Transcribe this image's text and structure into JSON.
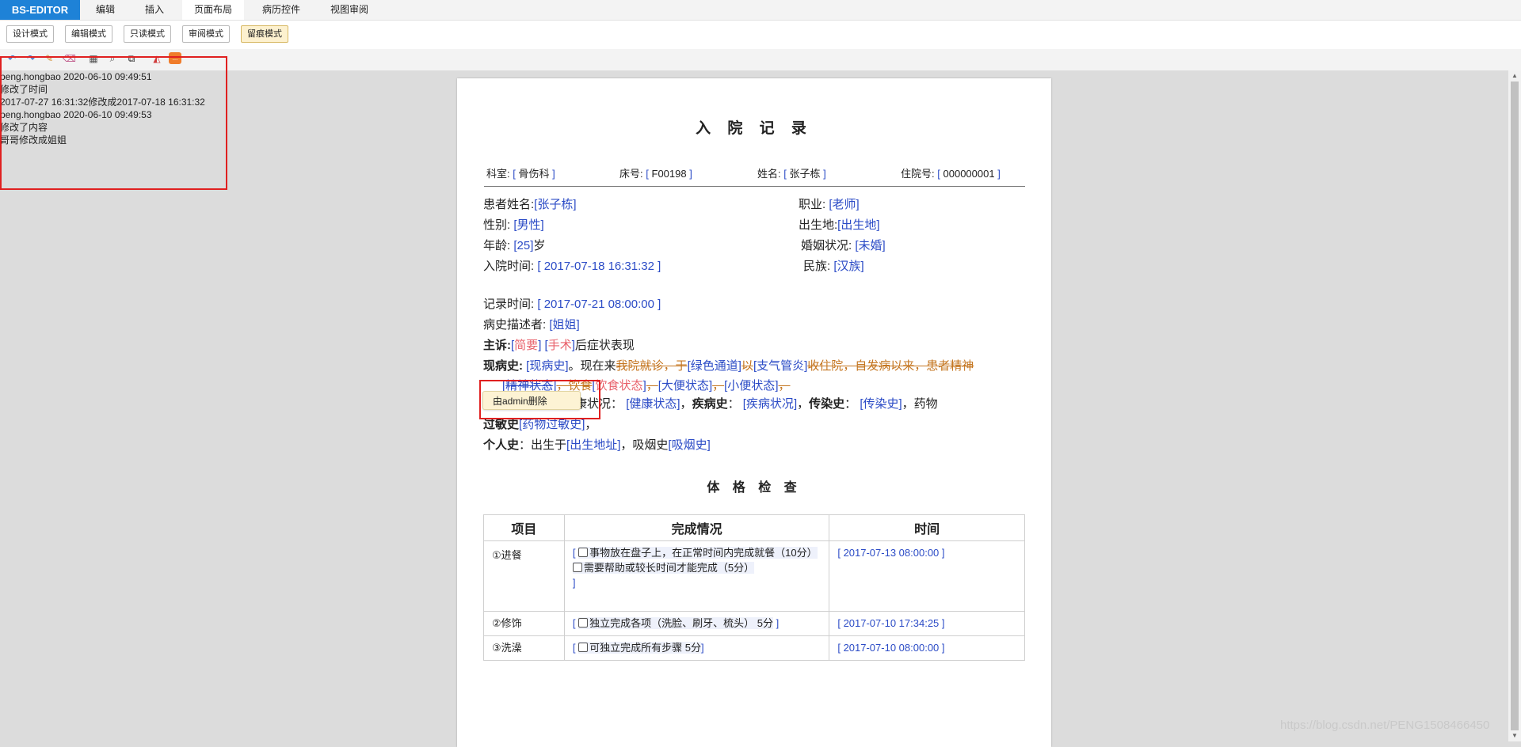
{
  "menubar": {
    "brand": "BS-EDITOR",
    "tabs": [
      "编辑",
      "插入",
      "页面布局",
      "病历控件",
      "视图审阅"
    ],
    "active_tab": "页面布局"
  },
  "modes": {
    "buttons": [
      "设计模式",
      "编辑模式",
      "只读模式",
      "审阅模式",
      "留痕模式"
    ],
    "active": "留痕模式"
  },
  "toolbar": {
    "icons": [
      "undo-icon",
      "redo-icon",
      "format-paint-icon",
      "eraser-icon",
      "print-icon",
      "print-preview-icon",
      "binoculars-icon",
      "layers-icon",
      "table-icon"
    ],
    "badge": "..."
  },
  "revision_log": [
    "peng.hongbao 2020-06-10 09:49:51",
    "修改了时间",
    "2017-07-27 16:31:32修改成2017-07-18 16:31:32",
    "peng.hongbao 2020-06-10 09:49:53",
    "修改了内容",
    "哥哥修改成姐姐"
  ],
  "document": {
    "title": "入 院 记 录",
    "header": {
      "dept_label": "科室:",
      "dept_value": "骨伤科",
      "bed_label": "床号:",
      "bed_value": "F00198",
      "name_label": "姓名:",
      "name_value": "张子栋",
      "admission_no_label": "住院号:",
      "admission_no_value": "000000001"
    },
    "patient": {
      "name_label": "患者姓名:",
      "name": "张子栋",
      "occupation_label": "职业:",
      "occupation": "老师",
      "gender_label": "性别:",
      "gender": "男性",
      "birthplace_label": "出生地:",
      "birthplace": "出生地",
      "age_label": "年龄:",
      "age": "25",
      "age_unit": "岁",
      "marital_label": "婚姻状况:",
      "marital": "未婚",
      "admit_time_label": "入院时间:",
      "admit_time": "2017-07-18 16:31:32",
      "ethnicity_label": "民族:",
      "ethnicity": "汉族"
    },
    "record": {
      "record_time_label": "记录时间:",
      "record_time": "2017-07-21 08:00:00",
      "narrator_label": "病史描述者:",
      "narrator": "姐姐",
      "chief_label": "主诉:",
      "chief_field1": "简要",
      "chief_field2": "手术",
      "chief_suffix": "后症状表现",
      "hpi_label": "现病史:",
      "hpi_field": "现病史",
      "hpi_text1": "。现在来",
      "hpi_strike1": "我院就诊，于",
      "hpi_field2": "绿色通道",
      "hpi_strike2": "以",
      "hpi_field3": "支气管炎",
      "hpi_strike3": "收住院，自发病以来，患者精神",
      "hpi_field4": "精神状态",
      "hpi_text2": "，饮食",
      "hpi_field5": "饮食状态",
      "hpi_field6": "大便状态",
      "hpi_field7": "小便状态",
      "past_partial": "康状况：",
      "past_field": "健康状态",
      "disease_label": "疾病史",
      "disease_field": "疾病状况",
      "infection_label": "传染史",
      "infection_field": "传染史",
      "drug_text": "，药物",
      "allergy_label": "过敏史",
      "allergy_field": "药物过敏史",
      "personal_label": "个人史",
      "personal_text1": "：出生于",
      "personal_field1": "出生地址",
      "personal_text2": "，吸烟史",
      "personal_field2": "吸烟史"
    },
    "tooltip": "由admin删除",
    "exam_title": "体 格 检 查",
    "table": {
      "headers": [
        "项目",
        "完成情况",
        "时间"
      ],
      "rows": [
        {
          "item": "①进餐",
          "options": [
            "事物放在盘子上，在正常时间内完成就餐（10分）",
            "需要帮助或较长时间才能完成（5分）"
          ],
          "time": "2017-07-13 08:00:00"
        },
        {
          "item": "②修饰",
          "options": [
            "独立完成各项（洗脸、刷牙、梳头） 5分"
          ],
          "time": "2017-07-10 17:34:25"
        },
        {
          "item": "③洗澡",
          "options": [
            "可独立完成所有步骤 5分"
          ],
          "time": "2017-07-10 08:00:00"
        }
      ]
    }
  },
  "watermark": "https://blog.csdn.net/PENG1508466450"
}
